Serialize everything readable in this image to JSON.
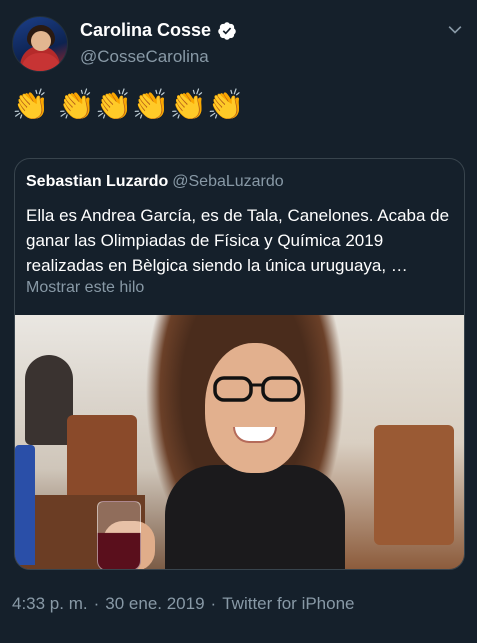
{
  "author": {
    "display_name": "Carolina Cosse",
    "handle": "@CosseCarolina",
    "verified": true
  },
  "tweet": {
    "text": "👏 👏👏👏👏👏"
  },
  "quoted": {
    "display_name": "Sebastian Luzardo",
    "handle": "@SebaLuzardo",
    "text": "Ella es Andrea García, es de Tala, Canelones. Acaba de ganar las Olimpiadas de Física y Química 2019 realizadas en Bèlgica siendo la única uruguaya, …",
    "show_thread": "Mostrar este hilo"
  },
  "meta": {
    "time": "4:33 p. m.",
    "date": "30 ene. 2019",
    "client": "Twitter for iPhone",
    "separator": "·"
  },
  "icons": {
    "verified": "verified-badge-icon",
    "menu": "chevron-down-icon"
  },
  "colors": {
    "background": "#15202b",
    "secondary_text": "#8899a6",
    "border": "#38444d"
  }
}
